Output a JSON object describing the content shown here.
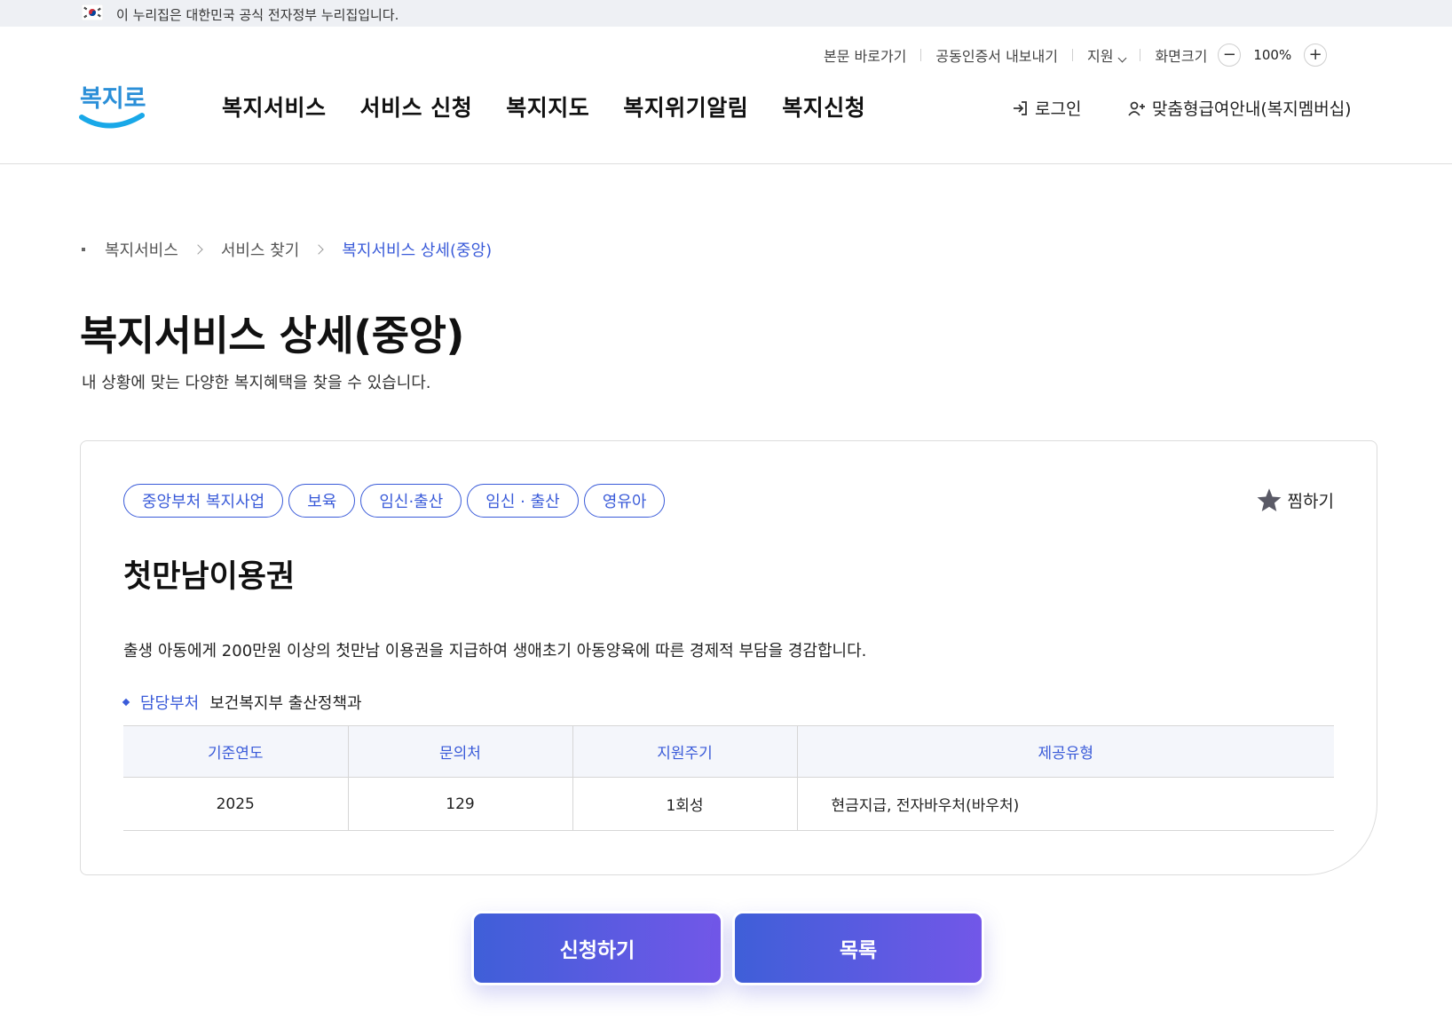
{
  "gov_banner": {
    "text": "이 누리집은 대한민국 공식 전자정부 누리집입니다."
  },
  "utility": {
    "skip_link": "본문 바로가기",
    "cert_export": "공동인증서 내보내기",
    "support": "지원",
    "screen_size": "화면크기",
    "zoom_value": "100%",
    "zoom_minus": "−",
    "zoom_plus": "+"
  },
  "logo": {
    "text": "복지로",
    "colors": {
      "text": "#2b8fd8",
      "swoosh": "#19a8e8"
    }
  },
  "nav": {
    "items": [
      "복지서비스",
      "서비스 신청",
      "복지지도",
      "복지위기알림",
      "복지신청"
    ]
  },
  "header": {
    "login": "로그인",
    "membership": "맞춤형급여안내(복지멤버십)"
  },
  "breadcrumb": {
    "items": [
      "복지서비스",
      "서비스 찾기",
      "복지서비스 상세(중앙)"
    ]
  },
  "page": {
    "title": "복지서비스 상세(중앙)",
    "description": "내 상황에 맞는 다양한 복지혜택을 찾을 수 있습니다."
  },
  "service": {
    "tags": [
      "중앙부처 복지사업",
      "보육",
      "임신·출산",
      "임신 · 출산",
      "영유아"
    ],
    "favorite": "찜하기",
    "title": "첫만남이용권",
    "description": "출생 아동에게 200만원 이상의 첫만남 이용권을 지급하여 생애초기 아동양육에 따른 경제적 부담을 경감합니다.",
    "dept_label": "담당부처",
    "dept_value": "보건복지부 출산정책과",
    "table": {
      "headers": [
        "기준연도",
        "문의처",
        "지원주기",
        "제공유형"
      ],
      "row": [
        "2025",
        "129",
        "1회성",
        "현금지급, 전자바우처(바우처)"
      ]
    }
  },
  "buttons": {
    "apply": "신청하기",
    "list": "목록"
  },
  "colors": {
    "accent": "#3a5bd9",
    "button_start": "#3f5fd8",
    "button_end": "#7257e8"
  }
}
